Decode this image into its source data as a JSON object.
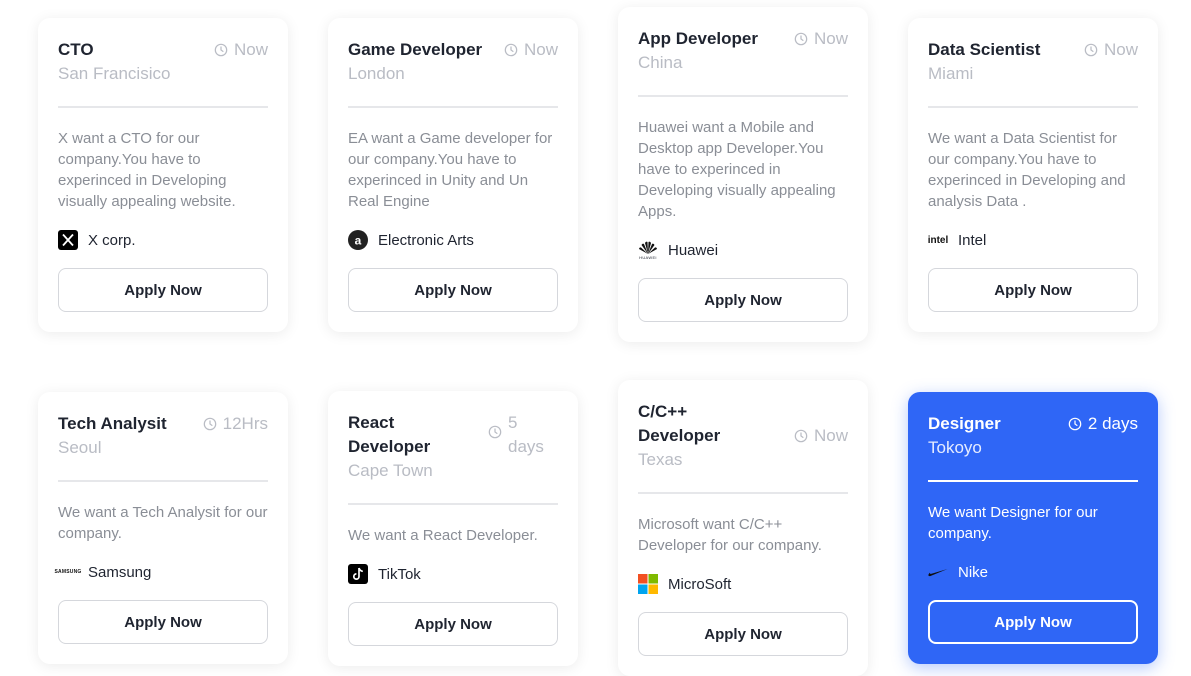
{
  "jobs": [
    {
      "title": "CTO",
      "location": "San Francisico",
      "time": "Now",
      "description": "X want a CTO for our company.You have to experinced in Developing visually appealing website.",
      "company": "X corp.",
      "logo": "x-logo-icon",
      "apply_label": "Apply Now"
    },
    {
      "title": "Game Developer",
      "location": "London",
      "time": "Now",
      "description": "EA want a Game developer for our company.You have to experinced in Unity and Un Real Engine",
      "company": "Electronic Arts",
      "logo": "ea-logo-icon",
      "apply_label": "Apply Now"
    },
    {
      "title": "App Developer",
      "location": "China",
      "time": "Now",
      "description": "Huawei want a Mobile and Desktop app Developer.You have to experinced in Developing visually appealing Apps.",
      "company": "Huawei",
      "logo": "huawei-logo-icon",
      "logo_caption": "HUAWEI",
      "apply_label": "Apply Now"
    },
    {
      "title": "Data Scientist",
      "location": "Miami",
      "time": "Now",
      "description": "We want a Data Scientist for our company.You have to experinced in Developing and analysis Data .",
      "company": "Intel",
      "logo": "intel-logo-icon",
      "logo_text": "intel",
      "apply_label": "Apply Now"
    },
    {
      "title": "Tech Analysit",
      "location": "Seoul",
      "time": "12Hrs",
      "description": "We want a Tech Analysit for our company.",
      "company": "Samsung",
      "logo": "samsung-logo-icon",
      "logo_text": "SAMSUNG",
      "apply_label": "Apply Now"
    },
    {
      "title": "React Developer",
      "location": "Cape Town",
      "time": "5 days",
      "description": "We want a React Developer.",
      "company": "TikTok",
      "logo": "tiktok-logo-icon",
      "apply_label": "Apply Now"
    },
    {
      "title": "C/C++ Developer",
      "location": "Texas",
      "time": "Now",
      "description": "Microsoft want C/C++ Developer for our company.",
      "company": "MicroSoft",
      "logo": "microsoft-logo-icon",
      "apply_label": "Apply Now"
    },
    {
      "title": "Designer",
      "location": "Tokoyo",
      "time": "2 days",
      "description": "We want Designer for our company.",
      "company": "Nike",
      "logo": "nike-logo-icon",
      "apply_label": "Apply Now"
    }
  ],
  "colors": {
    "accent": "#2f66f6",
    "muted": "#b9bcc4",
    "text": "#1f2430",
    "description": "#8a8e96"
  }
}
